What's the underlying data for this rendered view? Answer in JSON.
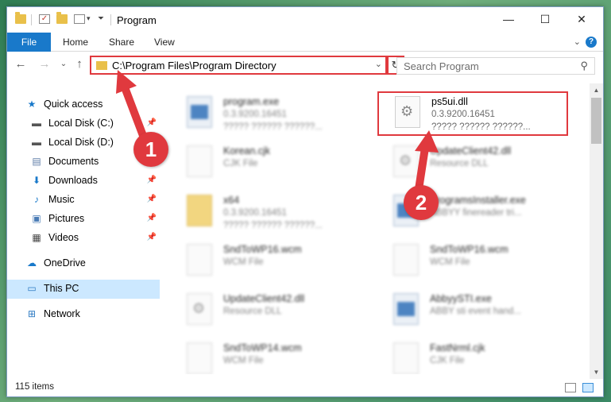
{
  "window": {
    "title": "Program",
    "minimize": "—",
    "maximize": "☐",
    "close": "✕"
  },
  "ribbon": {
    "tabs": [
      "File",
      "Home",
      "Share",
      "View"
    ],
    "expand": "⌄",
    "help": "?"
  },
  "nav": {
    "back": "←",
    "forward": "→",
    "recent": "⌄",
    "up": "↑",
    "address": "C:\\Program Files\\Program Directory",
    "dropdown": "⌄",
    "refresh": "↻",
    "search_placeholder": "Search Program",
    "search_icon": "⚲"
  },
  "sidebar": {
    "items": [
      {
        "label": "Quick access",
        "icon": "star-icon",
        "glyph": "★",
        "color": "#1979ca",
        "pinned": false
      },
      {
        "label": "Local Disk (C:)",
        "icon": "drive-icon",
        "glyph": "▬",
        "color": "#555555",
        "pinned": true
      },
      {
        "label": "Local Disk (D:)",
        "icon": "drive-icon",
        "glyph": "▬",
        "color": "#555555",
        "pinned": true
      },
      {
        "label": "Documents",
        "icon": "documents-icon",
        "glyph": "▤",
        "color": "#5f7ea8",
        "pinned": true
      },
      {
        "label": "Downloads",
        "icon": "downloads-icon",
        "glyph": "⬇",
        "color": "#1979ca",
        "pinned": true
      },
      {
        "label": "Music",
        "icon": "music-icon",
        "glyph": "♪",
        "color": "#1979ca",
        "pinned": true
      },
      {
        "label": "Pictures",
        "icon": "pictures-icon",
        "glyph": "▣",
        "color": "#4a7bb5",
        "pinned": true
      },
      {
        "label": "Videos",
        "icon": "videos-icon",
        "glyph": "▦",
        "color": "#444444",
        "pinned": true
      },
      {
        "label": "OneDrive",
        "icon": "onedrive-icon",
        "glyph": "☁",
        "color": "#1979ca",
        "pinned": false
      },
      {
        "label": "This PC",
        "icon": "computer-icon",
        "glyph": "▭",
        "color": "#2b79c2",
        "pinned": false
      },
      {
        "label": "Network",
        "icon": "network-icon",
        "glyph": "⊞",
        "color": "#2b79c2",
        "pinned": false
      }
    ],
    "pin_glyph": "📌"
  },
  "files": [
    {
      "name": "program.exe",
      "l2": "0.3.9200.16451",
      "l3": "????? ?????? ??????...",
      "type": "exe",
      "col": 0,
      "row": 0
    },
    {
      "name": "ps5ui.dll",
      "l2": "0.3.9200.16451",
      "l3": "????? ?????? ??????...",
      "type": "dll",
      "col": 1,
      "row": 0,
      "highlight": true
    },
    {
      "name": "Korean.cjk",
      "l2": "CJK File",
      "l3": "",
      "type": "doc",
      "col": 0,
      "row": 1
    },
    {
      "name": "UpdateClient42.dll",
      "l2": "Resource DLL",
      "l3": "",
      "type": "dll",
      "col": 1,
      "row": 1
    },
    {
      "name": "x64",
      "l2": "0.3.9200.16451",
      "l3": "????? ?????? ??????...",
      "type": "folder",
      "col": 0,
      "row": 2
    },
    {
      "name": "ProgramsInstaller.exe",
      "l2": "ABBYY finereader tri...",
      "l3": "",
      "type": "exe",
      "col": 1,
      "row": 2
    },
    {
      "name": "SndToWP16.wcm",
      "l2": "WCM File",
      "l3": "",
      "type": "doc",
      "col": 0,
      "row": 3
    },
    {
      "name": "SndToWP16.wcm",
      "l2": "WCM File",
      "l3": "",
      "type": "doc",
      "col": 1,
      "row": 3
    },
    {
      "name": "UpdateClient42.dll",
      "l2": "Resource DLL",
      "l3": "",
      "type": "dll",
      "col": 0,
      "row": 4
    },
    {
      "name": "AbbyySTI.exe",
      "l2": "ABBY sti event hand...",
      "l3": "",
      "type": "exe",
      "col": 1,
      "row": 4
    },
    {
      "name": "SndToWP14.wcm",
      "l2": "WCM File",
      "l3": "",
      "type": "doc",
      "col": 0,
      "row": 5
    },
    {
      "name": "FastNrml.cjk",
      "l2": "CJK File",
      "l3": "",
      "type": "doc",
      "col": 1,
      "row": 5
    }
  ],
  "status": {
    "items_count": "115 items"
  },
  "annotations": {
    "badge1": "1",
    "badge2": "2",
    "color": "#e0393e"
  }
}
